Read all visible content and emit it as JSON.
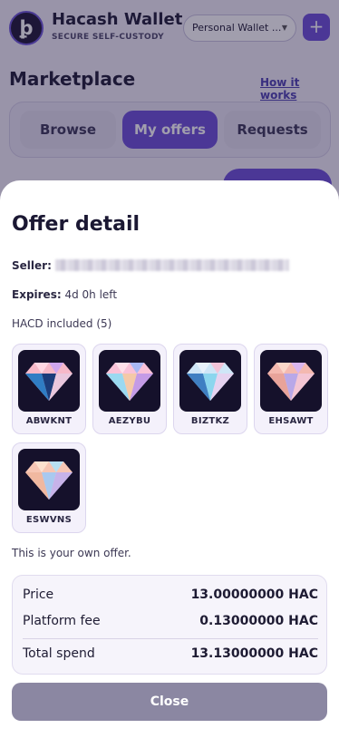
{
  "app": {
    "logo_glyph": "ꝧ",
    "title": "Hacash Wallet",
    "subtitle": "SECURE SELF-CUSTODY",
    "wallet_selector": "Personal Wallet ...",
    "add_label": "+"
  },
  "marketplace": {
    "title": "Marketplace",
    "how_link": "How it works",
    "tabs": [
      {
        "label": "Browse"
      },
      {
        "label": "My offers",
        "active": true
      },
      {
        "label": "Requests"
      }
    ]
  },
  "offer": {
    "title": "Offer detail",
    "seller_label": "Seller:",
    "expires_label": "Expires:",
    "expires_value": "4d 0h left",
    "hacd_heading": "HACD included (5)",
    "hacd": [
      {
        "name": "ABWKNT"
      },
      {
        "name": "AEZYBU"
      },
      {
        "name": "BIZTKZ"
      },
      {
        "name": "EHSAWT"
      },
      {
        "name": "ESWVNS"
      }
    ],
    "own_note": "This is your own offer.",
    "summary": {
      "price_label": "Price",
      "price_value": "13.00000000 HAC",
      "fee_label": "Platform fee",
      "fee_value": "0.13000000 HAC",
      "total_label": "Total spend",
      "total_value": "13.13000000 HAC"
    },
    "close_label": "Close"
  },
  "colors": {
    "accent": "#6b4fd8",
    "close_button": "#8b87a2",
    "card_bg": "#15112b"
  }
}
